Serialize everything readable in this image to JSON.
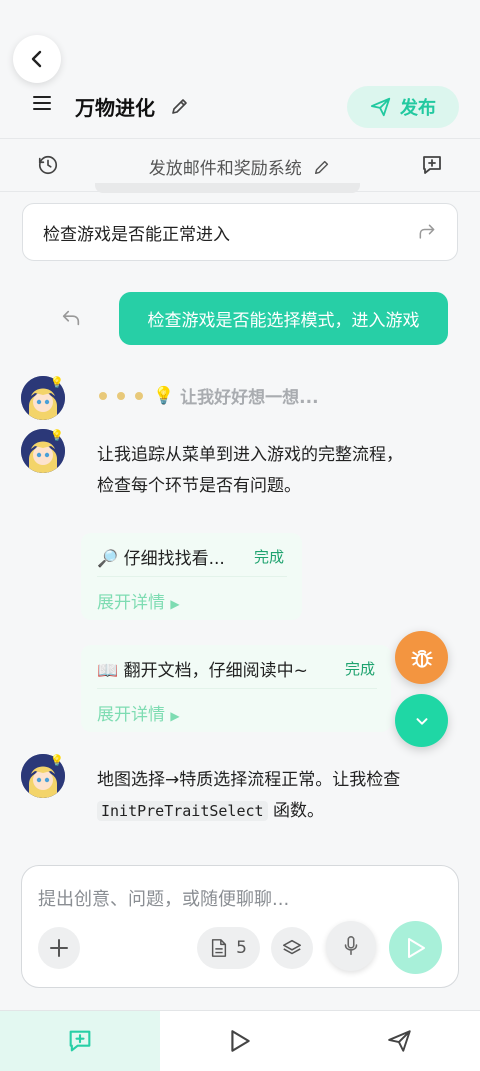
{
  "header": {
    "title": "万物进化",
    "publish_label": "发布"
  },
  "session": {
    "title": "发放邮件和奖励系统"
  },
  "messages": {
    "suggestion_card": "检查游戏是否能正常进入",
    "user_message": "检查游戏是否能选择模式，进入游戏",
    "thinking_text": "让我好好想一想...",
    "assistant_1_line1": "让我追踪从菜单到进入游戏的完整流程，",
    "assistant_1_line2": "检查每个环节是否有问题。",
    "tool_1": {
      "title": "仔细找找看...",
      "status": "完成",
      "expand": "展开详情"
    },
    "tool_2": {
      "title": "翻开文档，仔细阅读中~",
      "status": "完成",
      "expand": "展开详情"
    },
    "assistant_2_line1": "地图选择→特质选择流程正常。让我检查",
    "assistant_2_code": "InitPreTraitSelect",
    "assistant_2_suffix": "函数。"
  },
  "composer": {
    "placeholder": "提出创意、问题，或随便聊聊...",
    "file_count": "5"
  },
  "icons": {
    "thinking_emoji": "💡",
    "search_emoji": "🔎",
    "book_emoji": "📖"
  },
  "colors": {
    "accent": "#27cfa6",
    "fab_orange": "#f39540",
    "done_green": "#1fa36f"
  }
}
